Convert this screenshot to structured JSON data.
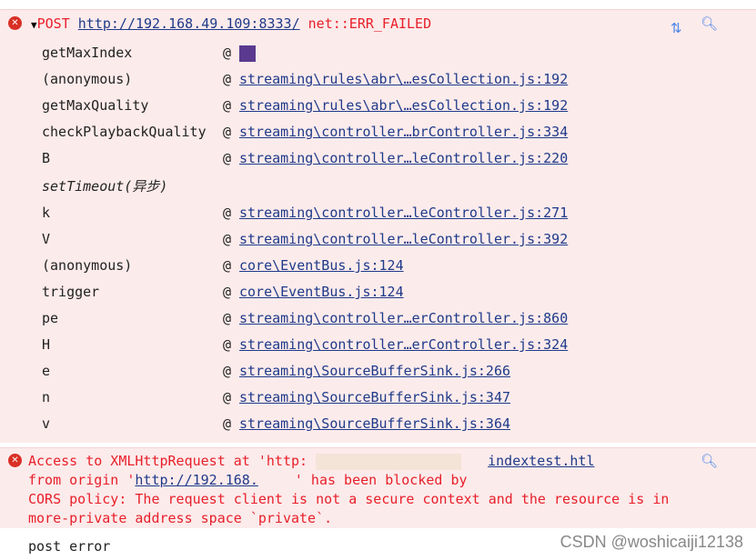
{
  "error1": {
    "method": "POST",
    "url": "http://192.168.49.109:8333/",
    "status": "net::ERR_FAILED",
    "stack": [
      {
        "fn": "getMaxIndex",
        "at": "@",
        "link": ""
      },
      {
        "fn": "(anonymous)",
        "at": "@",
        "link": "streaming\\rules\\abr\\…esCollection.js:192"
      },
      {
        "fn": "getMaxQuality",
        "at": "@",
        "link": "streaming\\rules\\abr\\…esCollection.js:192"
      },
      {
        "fn": "checkPlaybackQuality",
        "at": "@",
        "link": "streaming\\controller…brController.js:334"
      },
      {
        "fn": "B",
        "at": "@",
        "link": "streaming\\controller…leController.js:220"
      },
      {
        "fn": "setTimeout(异步)",
        "at": "",
        "link": "",
        "async": true
      },
      {
        "fn": "k",
        "at": "@",
        "link": "streaming\\controller…leController.js:271"
      },
      {
        "fn": "V",
        "at": "@",
        "link": "streaming\\controller…leController.js:392"
      },
      {
        "fn": "(anonymous)",
        "at": "@",
        "link": "core\\EventBus.js:124"
      },
      {
        "fn": "trigger",
        "at": "@",
        "link": "core\\EventBus.js:124"
      },
      {
        "fn": "pe",
        "at": "@",
        "link": "streaming\\controller…erController.js:860"
      },
      {
        "fn": "H",
        "at": "@",
        "link": "streaming\\controller…erController.js:324"
      },
      {
        "fn": "e",
        "at": "@",
        "link": "streaming\\SourceBufferSink.js:266"
      },
      {
        "fn": "n",
        "at": "@",
        "link": "streaming\\SourceBufferSink.js:347"
      },
      {
        "fn": "v",
        "at": "@",
        "link": "streaming\\SourceBufferSink.js:364"
      }
    ]
  },
  "error2": {
    "line1": "Access to XMLHttpRequest at 'http:",
    "link1": "indextest.htl",
    "line2a": "from origin '",
    "origin": "http://192.168.",
    "line2b": "' has been blocked by",
    "line3": "CORS policy: The request client is not a secure context and the resource is in",
    "line4": "more-private address space `private`."
  },
  "log": "post error",
  "watermark": "CSDN @woshicaiji12138",
  "icons": {
    "error": "error-circle-icon",
    "expand": "triangle-down-icon",
    "network": "network-arrows-icon",
    "search": "search-icon"
  }
}
